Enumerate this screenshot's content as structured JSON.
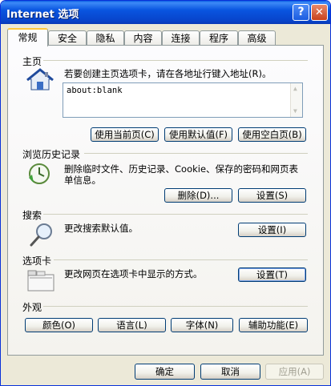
{
  "window": {
    "title": "Internet 选项",
    "help_glyph": "?",
    "close_glyph": "✕"
  },
  "tabs": [
    {
      "label": "常规",
      "active": true
    },
    {
      "label": "安全"
    },
    {
      "label": "隐私"
    },
    {
      "label": "内容"
    },
    {
      "label": "连接"
    },
    {
      "label": "程序"
    },
    {
      "label": "高级"
    }
  ],
  "homepage": {
    "title": "主页",
    "description": "若要创建主页选项卡，请在各地址行键入地址(R)。",
    "address_value": "about:blank",
    "buttons": [
      "使用当前页(C)",
      "使用默认值(F)",
      "使用空白页(B)"
    ]
  },
  "history": {
    "title": "浏览历史记录",
    "description": "删除临时文件、历史记录、Cookie、保存的密码和网页表单信息。",
    "buttons": [
      "删除(D)...",
      "设置(S)"
    ]
  },
  "search": {
    "title": "搜索",
    "description": "更改搜索默认值。",
    "button": "设置(I)"
  },
  "tabs_section": {
    "title": "选项卡",
    "description": "更改网页在选项卡中显示的方式。",
    "button": "设置(T)"
  },
  "appearance": {
    "title": "外观",
    "buttons": [
      "颜色(O)",
      "语言(L)",
      "字体(N)",
      "辅助功能(E)"
    ]
  },
  "footer": {
    "ok": "确定",
    "cancel": "取消",
    "apply": "应用(A)"
  },
  "colors": {
    "titlebar": "#0955e0",
    "focus_tab_accent": "#ffc83c",
    "face": "#ece9d8"
  }
}
